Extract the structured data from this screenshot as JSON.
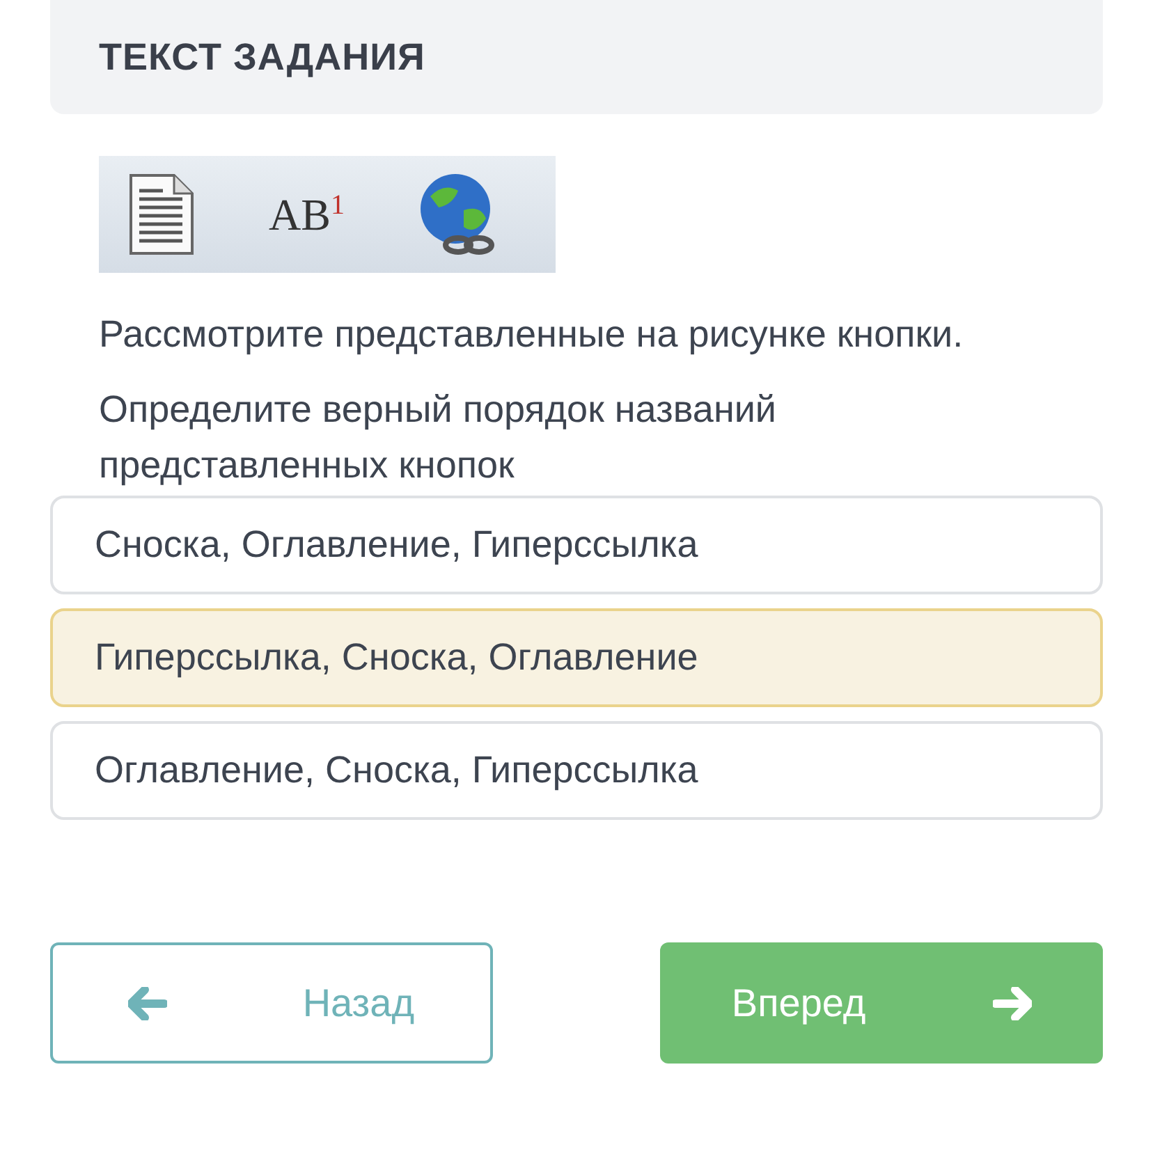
{
  "header": {
    "title": "ТЕКСТ ЗАДАНИЯ"
  },
  "toolbar_image": {
    "footnote_label": "AB$^{1}$"
  },
  "question": [
    "Рассмотрите представленные на рисунке кнопки.",
    "Определите верный порядок названий представленных кнопок"
  ],
  "options": [
    {
      "label": "Сноска, Оглавление, Гиперссылка",
      "selected": false
    },
    {
      "label": "Гиперссылка, Сноска, Оглавление",
      "selected": true
    },
    {
      "label": "Оглавление, Сноска, Гиперссылка",
      "selected": false
    }
  ],
  "buttons": {
    "back": "Назад",
    "next": "Вперед"
  }
}
